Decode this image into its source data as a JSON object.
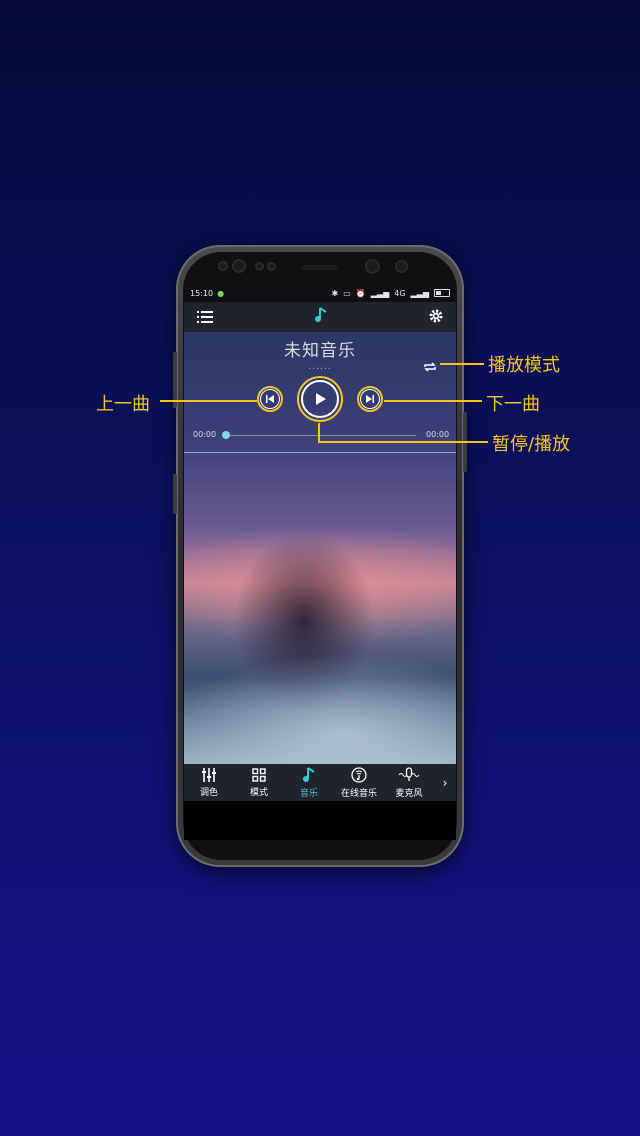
{
  "statusbar": {
    "time": "15:10",
    "network": "4G"
  },
  "player": {
    "song_title": "未知音乐",
    "lyric_placeholder": "......",
    "time_current": "00:00",
    "time_total": "00:00",
    "progress": 0
  },
  "tabs": [
    {
      "label": "调色",
      "icon": "equalizer-icon"
    },
    {
      "label": "模式",
      "icon": "grid-icon"
    },
    {
      "label": "音乐",
      "icon": "music-note-icon",
      "active": true
    },
    {
      "label": "在线音乐",
      "icon": "online-music-icon"
    },
    {
      "label": "麦克风",
      "icon": "microphone-icon"
    }
  ],
  "callouts": {
    "play_mode": "播放模式",
    "previous": "上一曲",
    "next": "下一曲",
    "play_pause": "暂停/播放"
  },
  "colors": {
    "accent": "#3fc7d6",
    "highlight": "#f5c518",
    "background": "#0b1160"
  }
}
